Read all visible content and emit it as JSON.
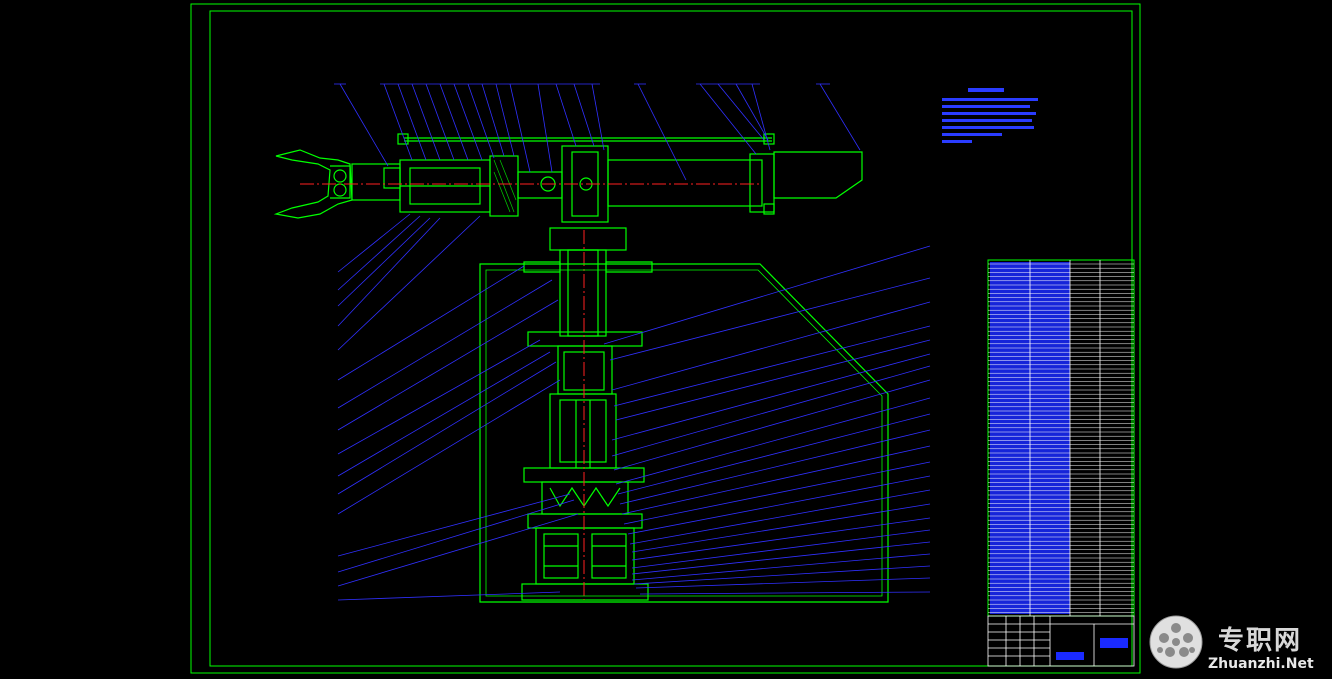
{
  "drawing": {
    "background": "#000000",
    "frame_color": "#00ff00",
    "part_color": "#00ff00",
    "centerline_color": "#ff2020",
    "callout_color": "#3030ff",
    "hatch_color": "#00cc00"
  },
  "watermark": {
    "cn_text": "专职网",
    "en_text": "Zhuanzhi.Net",
    "icon": "globe-ball-icon"
  }
}
